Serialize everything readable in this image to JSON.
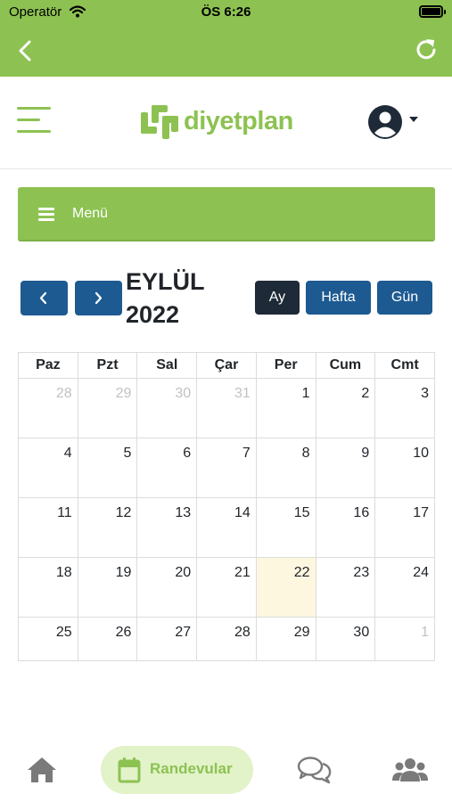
{
  "status_bar": {
    "carrier": "Operatör",
    "time": "ÖS 6:26",
    "wifi_icon": "wifi-icon",
    "battery_icon": "battery-icon"
  },
  "app_bar": {
    "back_icon": "chevron-left-icon",
    "refresh_icon": "refresh-icon",
    "color": "#8dc252"
  },
  "header": {
    "logo_text": "diyetplan",
    "menu_icon": "hamburger-icon",
    "user_icon": "user-avatar-icon"
  },
  "menu_bar": {
    "label": "Menü",
    "icon": "bars-icon"
  },
  "calendar": {
    "title_month": "EYLÜL",
    "title_year": "2022",
    "prev_icon": "chevron-left-icon",
    "next_icon": "chevron-right-icon",
    "views": [
      "Ay",
      "Hafta",
      "Gün"
    ],
    "active_view": "Ay",
    "weekdays": [
      "Paz",
      "Pzt",
      "Sal",
      "Çar",
      "Per",
      "Cum",
      "Cmt"
    ],
    "weeks": [
      [
        "28",
        "29",
        "30",
        "31",
        "1",
        "2",
        "3"
      ],
      [
        "4",
        "5",
        "6",
        "7",
        "8",
        "9",
        "10"
      ],
      [
        "11",
        "12",
        "13",
        "14",
        "15",
        "16",
        "17"
      ],
      [
        "18",
        "19",
        "20",
        "21",
        "22",
        "23",
        "24"
      ],
      [
        "25",
        "26",
        "27",
        "28",
        "29",
        "30",
        "1"
      ]
    ],
    "today": "22",
    "colors": {
      "button": "#1d5a91",
      "active_button": "#1e2a37",
      "today_bg": "#fdf7e0"
    }
  },
  "bottom_nav": {
    "items": [
      {
        "icon": "home-icon"
      },
      {
        "icon": "calendar-icon",
        "label": "Randevular",
        "active": true
      },
      {
        "icon": "chat-icon"
      },
      {
        "icon": "users-icon"
      }
    ]
  }
}
